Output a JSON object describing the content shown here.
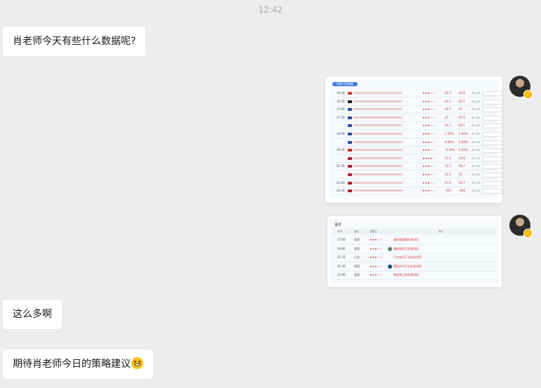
{
  "timestamp": "12:42",
  "messages": {
    "m1": "肖老师今天有些什么数据呢?",
    "m2": "这么多啊",
    "m3": "期待肖老师今日的策略建议"
  },
  "calendar_image": {
    "header": "财经日历数据",
    "rows": [
      {
        "time": "15:30",
        "flag": "#e03c31",
        "stars": "★★★☆☆",
        "prev": "42.7",
        "fore": "43.6",
        "act": "未公布"
      },
      {
        "time": "15:30",
        "flag": "#222",
        "stars": "★★★☆☆",
        "prev": "45.5",
        "fore": "45.1",
        "act": "未公布"
      },
      {
        "time": "17:00",
        "flag": "#2a4fa0",
        "stars": "★★★☆☆",
        "prev": "46.5",
        "fore": "47",
        "act": "未公布"
      },
      {
        "time": "17:30",
        "flag": "#2a4fa0",
        "stars": "★★★☆☆",
        "prev": "47",
        "fore": "47.6",
        "act": "未公布"
      },
      {
        "time": "",
        "flag": "#2a4fa0",
        "stars": "★★★☆☆",
        "prev": "54.3",
        "fore": "54.1",
        "act": "未公布"
      },
      {
        "time": "18:00",
        "flag": "#2a4fa0",
        "stars": "★★★☆☆",
        "prev": "1.50%",
        "fore": "2.30%",
        "act": "未公布"
      },
      {
        "time": "",
        "flag": "#2a4fa0",
        "stars": "★★★☆☆",
        "prev": "0.40%",
        "fore": "0.40%",
        "act": "未公布"
      },
      {
        "time": "20:30",
        "flag": "#d52b1e",
        "stars": "★★★☆☆",
        "prev": "-0.30%",
        "fore": "0.20%",
        "act": "未公布"
      },
      {
        "time": "",
        "flag": "#b22234",
        "stars": "★★★★☆",
        "prev": "21.4",
        "fore": "23.6",
        "act": "未公布"
      },
      {
        "time": "21:45",
        "flag": "#b22234",
        "stars": "★★★☆☆",
        "prev": "50.7",
        "fore": "50.7",
        "act": "未公布"
      },
      {
        "time": "",
        "flag": "#b22234",
        "stars": "★★★☆☆",
        "prev": "52.3",
        "fore": "52",
        "act": "未公布"
      },
      {
        "time": "22:00",
        "flag": "#b22234",
        "stars": "★★★☆☆",
        "prev": "57.0",
        "fore": "55.7",
        "act": "未公布"
      },
      {
        "time": "22:30",
        "flag": "#b22234",
        "stars": "★★★☆☆",
        "prev": "-450",
        "fore": "-640",
        "act": "未公布"
      }
    ]
  },
  "events_image": {
    "title": "事件",
    "columns": [
      "时间",
      "国家",
      "重要性",
      "事件"
    ],
    "rows": [
      {
        "time": "17:00",
        "country": "美国",
        "stars": "★★★☆☆",
        "text": "美联储理事发表讲话",
        "dot": ""
      },
      {
        "time": "20:00",
        "country": "美国",
        "stars": "★★★☆☆",
        "text": "美联储官员发表讲话",
        "dot": "#4b8b5a"
      },
      {
        "time": "21:15",
        "country": "日本",
        "stars": "★★★☆☆",
        "text": "日本央行行长发表讲话",
        "dot": ""
      },
      {
        "time": "22:30",
        "country": "德国",
        "stars": "★★★☆☆",
        "text": "德国央行行长发表讲话",
        "dot": "#145a7a"
      },
      {
        "time": "23:00",
        "country": "美国",
        "stars": "★★★☆☆",
        "text": "美联储主席发表讲话",
        "dot": ""
      }
    ]
  }
}
